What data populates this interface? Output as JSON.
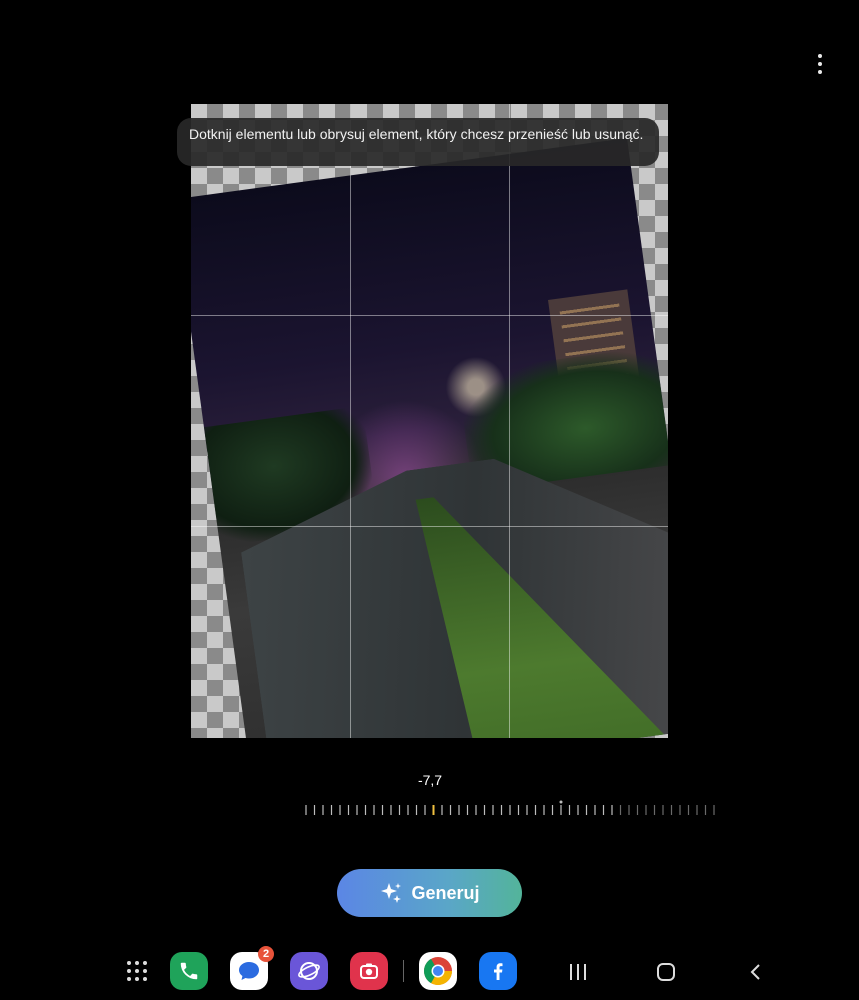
{
  "tooltip": {
    "text": "Dotknij elementu lub obrysuj element, który chcesz przenieść lub usunąć."
  },
  "editor": {
    "rotation_value": "-7,7"
  },
  "actions": {
    "generate_label": "Generuj"
  },
  "taskbar": {
    "messages_badge": "2"
  },
  "icons": {
    "more": "more-vertical-icon",
    "sparkle": "sparkle-icon",
    "apps": "apps-grid-icon",
    "phone": "phone-icon",
    "messages": "messages-icon",
    "internet": "internet-icon",
    "camera": "camera-icon",
    "chrome": "chrome-icon",
    "facebook": "facebook-icon",
    "recents": "recents-icon",
    "home": "home-icon",
    "back": "back-icon"
  },
  "colors": {
    "accent_start": "#5b86e5",
    "accent_end": "#53b49a",
    "ruler_marker": "#f0c040"
  }
}
